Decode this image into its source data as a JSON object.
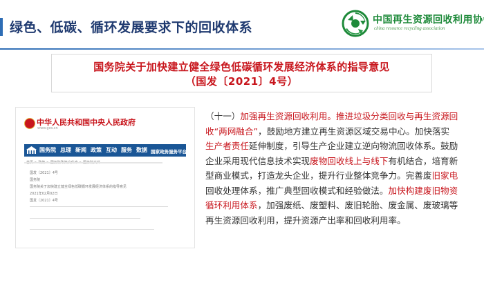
{
  "header": {
    "title": "绿色、低碳、循环发展要求下的回收体系",
    "logo_cn": "中国再生资源回收利用协会",
    "logo_en": "china resource recycling association",
    "accent": "#2e6db5"
  },
  "document": {
    "title": "国务院关于加快建立健全绿色低碳循环发展经济体系的指导意见",
    "number": "（国发〔2021〕4号）",
    "color": "#c8161d"
  },
  "gov_site": {
    "name": "中华人民共和国中央人民政府",
    "url": "www.gov.cn",
    "nav": [
      "国务院",
      "总理",
      "新闻",
      "政策",
      "互动",
      "服务",
      "数据",
      "国家政务服务平台"
    ],
    "crumb": "首页 > 政策 > 国务院政策文件库 > 国务院文件",
    "rows": [
      "国发〔2021〕4号",
      "国务院",
      "国务院关于加快建立健全绿色低碳循环发展经济体系的指导意见",
      "2021年02月02日",
      "国发〔2021〕4号"
    ]
  },
  "body": {
    "l1a": "（十一）",
    "l1b": "加强再生资源回收利用。推进垃圾分类回收与再生资源回",
    "l2a": "收“两网融合”",
    "l2b": "，鼓励地方建立再生资源区域交易中心。加快落实",
    "l3a": "生产者责任",
    "l3b": "延伸制度，引导生产企业建立逆向物流回收体系。鼓励",
    "l4a": "企业采用现代信息技术实现",
    "l4b": "废物回收线上与线下",
    "l4c": "有机结合，培育新",
    "l5": "型商业模式，打造龙头企业，提升行业整体竞争力。完善废",
    "l5b": "旧家电",
    "l6": "回收处理体系，推广典型回收模式和经验做法。",
    "l6b": "加快构建废旧物资",
    "l7a": "循环利用体系",
    "l7b": "，加强废纸、废塑料、废旧轮胎、废金属、废玻璃等",
    "l8": "再生资源回收利用，提升资源产出率和回收利用率。"
  }
}
